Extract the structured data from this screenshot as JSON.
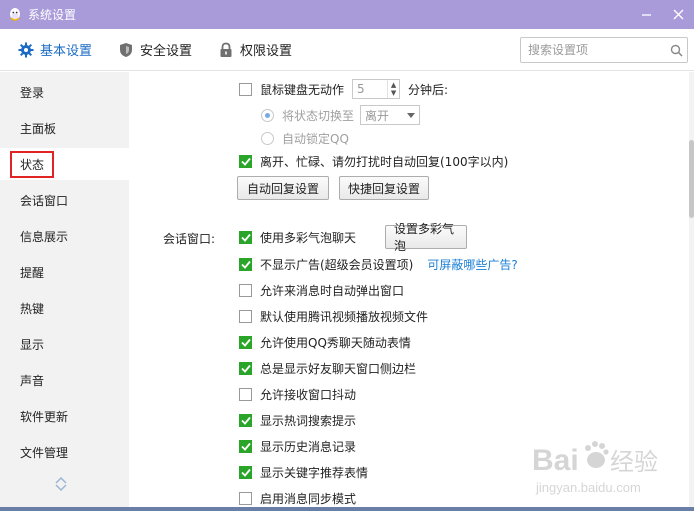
{
  "window": {
    "title": "系统设置"
  },
  "toolbar": {
    "tabs": [
      {
        "label": "基本设置",
        "icon": "gear-icon"
      },
      {
        "label": "安全设置",
        "icon": "shield-icon"
      },
      {
        "label": "权限设置",
        "icon": "lock-icon"
      }
    ],
    "search_placeholder": "搜索设置项"
  },
  "sidebar": {
    "items": [
      {
        "label": "登录"
      },
      {
        "label": "主面板"
      },
      {
        "label": "状态"
      },
      {
        "label": "会话窗口"
      },
      {
        "label": "信息展示"
      },
      {
        "label": "提醒"
      },
      {
        "label": "热键"
      },
      {
        "label": "显示"
      },
      {
        "label": "声音"
      },
      {
        "label": "软件更新"
      },
      {
        "label": "文件管理"
      }
    ],
    "active": "状态"
  },
  "status": {
    "idle_label": "鼠标键盘无动作",
    "idle_minutes": "5",
    "idle_suffix": "分钟后:",
    "switch_label": "将状态切换至",
    "switch_value": "离开",
    "autolock_label": "自动锁定QQ",
    "autoreply_label": "离开、忙碌、请勿打扰时自动回复(100字以内)",
    "autoreply_btn": "自动回复设置",
    "quickreply_btn": "快捷回复设置"
  },
  "chat_window": {
    "section_label": "会话窗口:",
    "bubble_label": "使用多彩气泡聊天",
    "bubble_btn": "设置多彩气泡",
    "noads_label": "不显示广告(超级会员设置项)",
    "noads_link": "可屏蔽哪些广告?",
    "options": [
      {
        "label": "允许来消息时自动弹出窗口",
        "checked": false
      },
      {
        "label": "默认使用腾讯视频播放视频文件",
        "checked": false
      },
      {
        "label": "允许使用QQ秀聊天随动表情",
        "checked": true
      },
      {
        "label": "总是显示好友聊天窗口侧边栏",
        "checked": true
      },
      {
        "label": "允许接收窗口抖动",
        "checked": false
      },
      {
        "label": "显示热词搜索提示",
        "checked": true
      },
      {
        "label": "显示历史消息记录",
        "checked": true
      },
      {
        "label": "显示关键字推荐表情",
        "checked": true
      },
      {
        "label": "启用消息同步模式",
        "checked": false
      }
    ]
  },
  "colors": {
    "titlebar": "#a99ad9",
    "accent": "#1b6bc4",
    "check": "#2aa52a",
    "highlight": "#e02424",
    "link": "#1b7fd6"
  },
  "watermark": {
    "brand": "Bai",
    "brand2": "经验",
    "url": "jingyan.baidu.com"
  }
}
